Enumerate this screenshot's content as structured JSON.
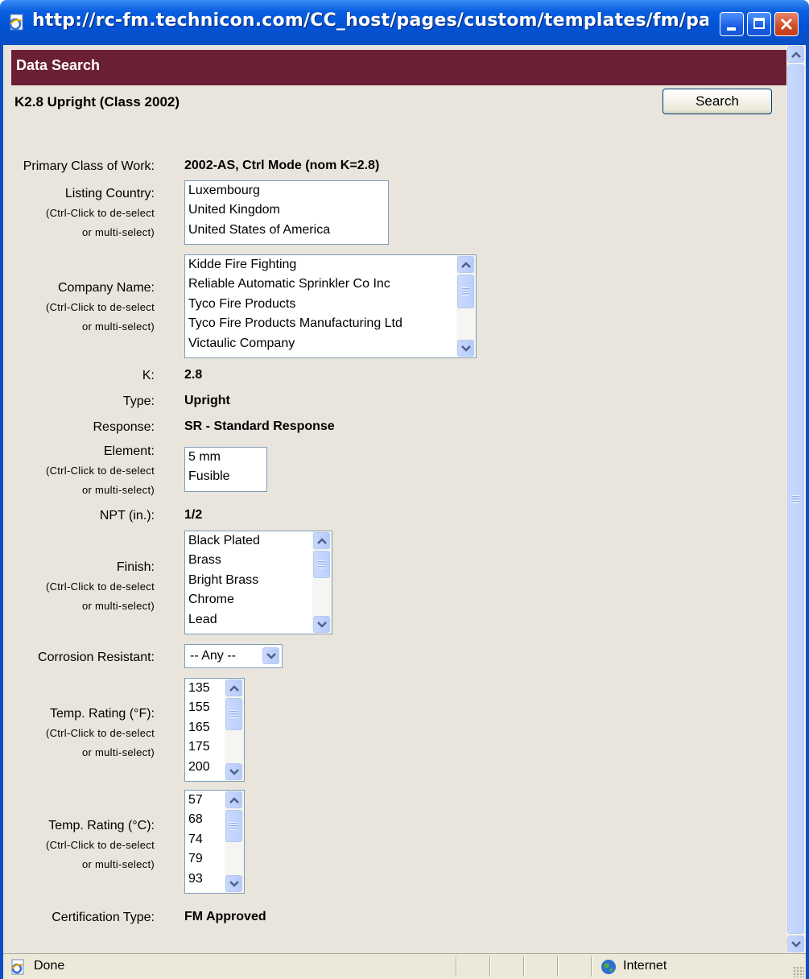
{
  "window": {
    "title": "http://rc-fm.technicon.com/CC_host/pages/custom/templates/fm/paramet…"
  },
  "banner": {
    "title": "Data Search"
  },
  "header": {
    "subtitle": "K2.8 Upright (Class 2002)",
    "search_label": "Search"
  },
  "hint": {
    "line1": "(Ctrl-Click to de-select",
    "line2": "or multi-select)"
  },
  "form": {
    "primary_class": {
      "label": "Primary Class of Work:",
      "value": "2002-AS, Ctrl Mode (nom K=2.8)"
    },
    "listing_country": {
      "label": "Listing Country:",
      "options": [
        "Luxembourg",
        "United Kingdom",
        "United States of America"
      ]
    },
    "company_name": {
      "label": "Company Name:",
      "options": [
        "Kidde Fire Fighting",
        "Reliable Automatic Sprinkler Co Inc",
        "Tyco Fire Products",
        "Tyco Fire Products Manufacturing Ltd",
        "Victaulic Company"
      ]
    },
    "k": {
      "label": "K:",
      "value": "2.8"
    },
    "type": {
      "label": "Type:",
      "value": "Upright"
    },
    "response": {
      "label": "Response:",
      "value": "SR - Standard Response"
    },
    "element": {
      "label": "Element:",
      "options": [
        "5 mm",
        "Fusible"
      ]
    },
    "npt": {
      "label": "NPT (in.):",
      "value": "1/2"
    },
    "finish": {
      "label": "Finish:",
      "options": [
        "Black Plated",
        "Brass",
        "Bright Brass",
        "Chrome",
        "Lead"
      ]
    },
    "corrosion": {
      "label": "Corrosion Resistant:",
      "selected": "-- Any --"
    },
    "temp_f": {
      "label": "Temp. Rating (°F):",
      "options": [
        "135",
        "155",
        "165",
        "175",
        "200"
      ]
    },
    "temp_c": {
      "label": "Temp. Rating (°C):",
      "options": [
        "57",
        "68",
        "74",
        "79",
        "93"
      ]
    },
    "certification": {
      "label": "Certification Type:",
      "value": "FM Approved"
    }
  },
  "status": {
    "text": "Done",
    "zone": "Internet"
  },
  "colors": {
    "banner": "#6b1f35",
    "page_bg": "#e9e5dc",
    "titlebar": "#0a5fe0"
  }
}
